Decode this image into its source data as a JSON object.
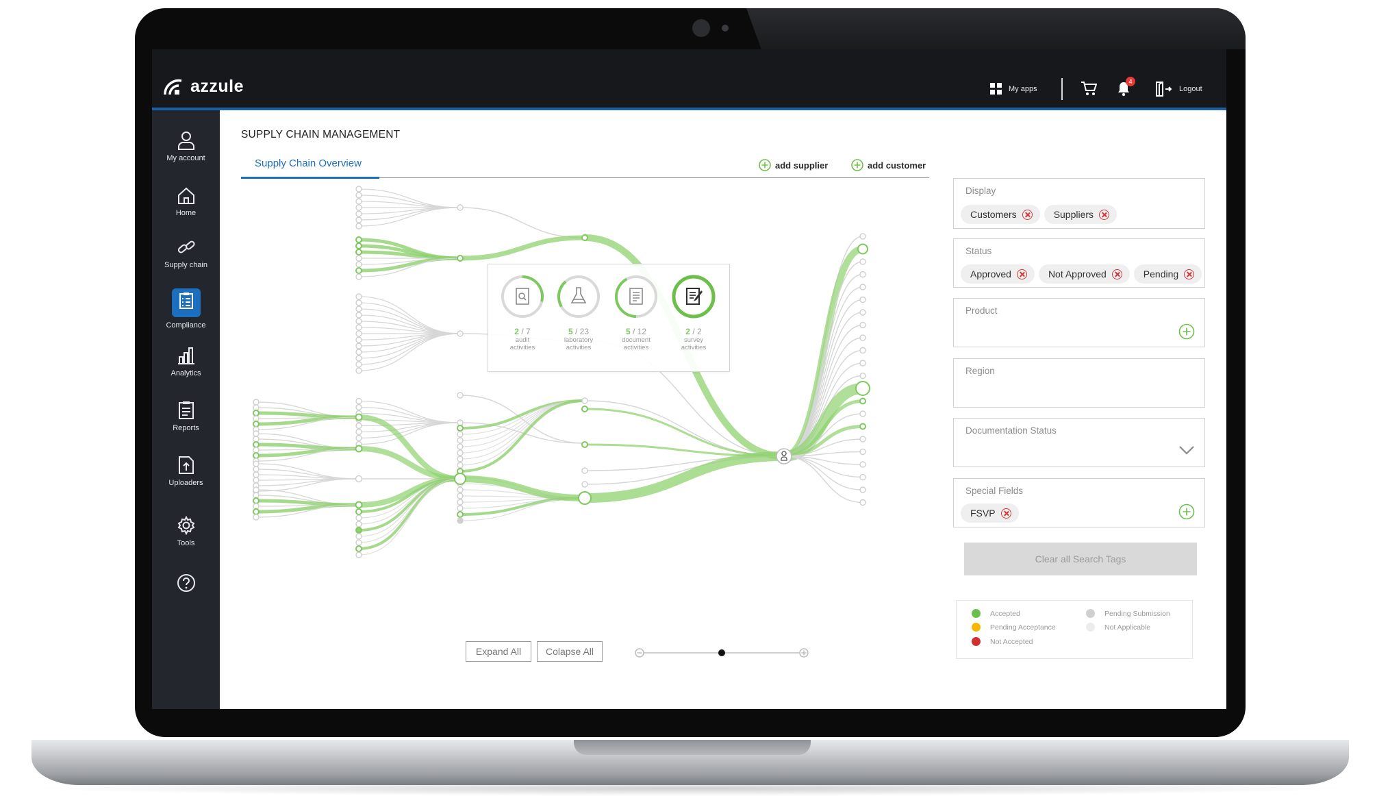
{
  "app": {
    "brand": "azzule"
  },
  "topbar": {
    "my_apps": "My apps",
    "logout": "Logout",
    "notification_count": "4"
  },
  "sidebar": {
    "items": [
      {
        "label": "My account",
        "icon": "user-icon"
      },
      {
        "label": "Home",
        "icon": "home-icon"
      },
      {
        "label": "Supply chain",
        "icon": "link-icon"
      },
      {
        "label": "Compliance",
        "icon": "checklist-icon",
        "active": true
      },
      {
        "label": "Analytics",
        "icon": "bar-chart-icon"
      },
      {
        "label": "Reports",
        "icon": "report-icon"
      },
      {
        "label": "Uploaders",
        "icon": "upload-icon"
      },
      {
        "label": "Tools",
        "icon": "gear-icon"
      },
      {
        "label": "",
        "icon": "help-icon"
      }
    ]
  },
  "page": {
    "title": "SUPPLY CHAIN MANAGEMENT",
    "tab": "Supply Chain Overview",
    "add_supplier": "add supplier",
    "add_customer": "add customer"
  },
  "activities": [
    {
      "done": "2",
      "total": "7",
      "label1": "audit",
      "label2": "activities",
      "progress": 0.29,
      "icon": "audit-icon"
    },
    {
      "done": "5",
      "total": "23",
      "label1": "laboratory",
      "label2": "activities",
      "progress": 0.22,
      "icon": "flask-icon"
    },
    {
      "done": "5",
      "total": "12",
      "label1": "document",
      "label2": "activities",
      "progress": 0.42,
      "icon": "document-icon"
    },
    {
      "done": "2",
      "total": "2",
      "label1": "survey",
      "label2": "activities",
      "progress": 1.0,
      "icon": "survey-icon"
    }
  ],
  "controls": {
    "expand_all": "Expand All",
    "collapse_all": "Colapse All",
    "zoom_level": 0.5
  },
  "filters": {
    "display": {
      "label": "Display",
      "tags": [
        "Customers",
        "Suppliers"
      ]
    },
    "status": {
      "label": "Status",
      "tags": [
        "Approved",
        "Not Approved",
        "Pending"
      ]
    },
    "product": {
      "label": "Product"
    },
    "region": {
      "label": "Region"
    },
    "documentation_status": {
      "label": "Documentation Status"
    },
    "special_fields": {
      "label": "Special Fields",
      "tags": [
        "FSVP"
      ]
    },
    "clear_all": "Clear all Search Tags"
  },
  "legend": [
    {
      "label": "Accepted",
      "color": "#6cc04a"
    },
    {
      "label": "Pending Acceptance",
      "color": "#f5b800"
    },
    {
      "label": "Not Accepted",
      "color": "#d32f2f"
    },
    {
      "label": "Pending Submission",
      "color": "#cfcfcf"
    },
    {
      "label": "Not Applicable",
      "color": "#ececec"
    }
  ],
  "colors": {
    "accent": "#1c6fbf",
    "green": "#7ec860",
    "topbar": "#16181b",
    "sidebar": "#23272d"
  }
}
